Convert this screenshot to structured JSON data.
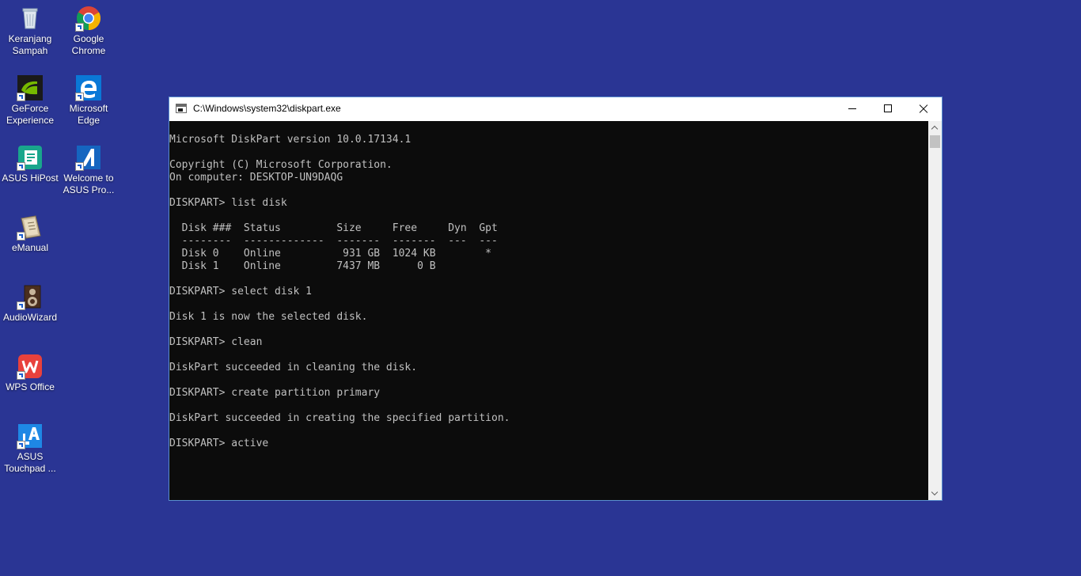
{
  "desktop": {
    "background": "#2a3594",
    "icons": [
      {
        "label": "Keranjang\nSampah",
        "icon": "recycle-bin-icon"
      },
      {
        "label": "Google\nChrome",
        "icon": "chrome-icon"
      },
      {
        "label": "GeForce\nExperience",
        "icon": "geforce-icon"
      },
      {
        "label": "Microsoft\nEdge",
        "icon": "edge-icon"
      },
      {
        "label": "ASUS HiPost",
        "icon": "asus-hipost-icon"
      },
      {
        "label": "Welcome to\nASUS Pro...",
        "icon": "asus-welcome-icon"
      },
      {
        "label": "eManual",
        "icon": "emanual-icon"
      },
      {
        "label": "AudioWizard",
        "icon": "audiowizard-icon"
      },
      {
        "label": "WPS Office",
        "icon": "wps-office-icon"
      },
      {
        "label": "ASUS\nTouchpad ...",
        "icon": "asus-touchpad-icon"
      }
    ]
  },
  "window": {
    "title": "C:\\Windows\\system32\\diskpart.exe",
    "console_lines": [
      "Microsoft DiskPart version 10.0.17134.1",
      "",
      "Copyright (C) Microsoft Corporation.",
      "On computer: DESKTOP-UN9DAQG",
      "",
      "DISKPART> list disk",
      "",
      "  Disk ###  Status         Size     Free     Dyn  Gpt",
      "  --------  -------------  -------  -------  ---  ---",
      "  Disk 0    Online          931 GB  1024 KB        *",
      "  Disk 1    Online         7437 MB      0 B",
      "",
      "DISKPART> select disk 1",
      "",
      "Disk 1 is now the selected disk.",
      "",
      "DISKPART> clean",
      "",
      "DiskPart succeeded in cleaning the disk.",
      "",
      "DISKPART> create partition primary",
      "",
      "DiskPart succeeded in creating the specified partition.",
      "",
      "DISKPART> active"
    ]
  }
}
